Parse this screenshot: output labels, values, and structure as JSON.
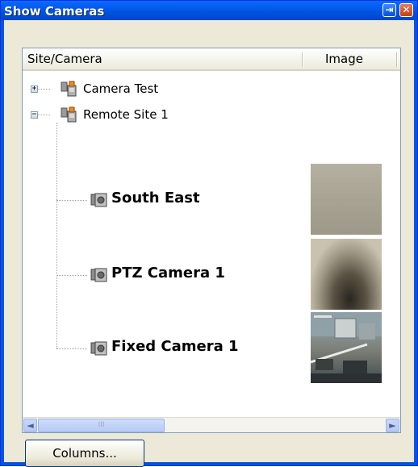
{
  "window": {
    "title": "Show Cameras"
  },
  "header": {
    "columns": [
      "Site/Camera",
      "Image"
    ]
  },
  "tree": {
    "sites": [
      {
        "label": "Camera Test",
        "expanded": false,
        "expander": "+"
      },
      {
        "label": "Remote Site 1",
        "expanded": true,
        "expander": "−"
      }
    ],
    "cameras": [
      {
        "label": "South East"
      },
      {
        "label": "PTZ Camera 1"
      },
      {
        "label": "Fixed Camera 1"
      }
    ]
  },
  "scrollbar": {
    "left_arrow": "◄",
    "right_arrow": "►",
    "grip": "III"
  },
  "footer": {
    "columns_button": "Columns..."
  },
  "titlebar_buttons": {
    "pin": "⇥",
    "close": "✕"
  },
  "colors": {
    "title_bar": "#0054e3",
    "panel": "#ece9d8",
    "list_border": "#7f9db9"
  }
}
